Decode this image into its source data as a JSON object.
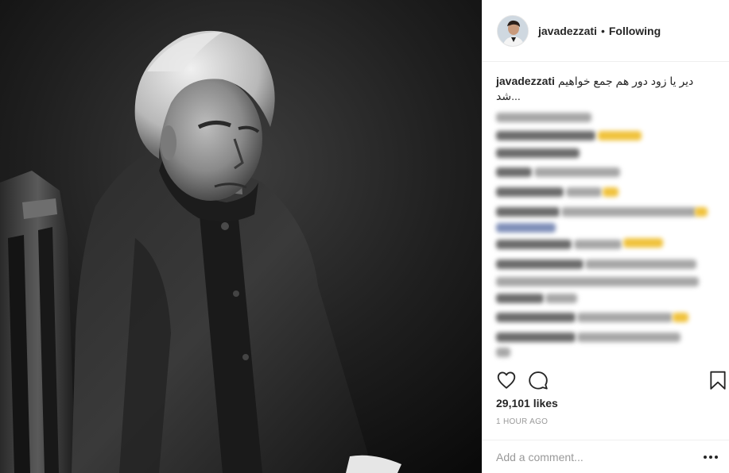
{
  "post": {
    "username": "javadezzati",
    "follow_status": "Following",
    "separator": "•",
    "caption_text": "دیر یا زود دور هم جمع خواهیم",
    "caption_text_line2": "شد...",
    "likes_label": "29,101 likes",
    "time_label": "1 HOUR AGO",
    "comment_placeholder": "Add a comment..."
  },
  "icons": {
    "like": "heart-outline-icon",
    "comment": "speech-bubble-icon",
    "save": "bookmark-icon",
    "more": "ellipsis-icon"
  }
}
